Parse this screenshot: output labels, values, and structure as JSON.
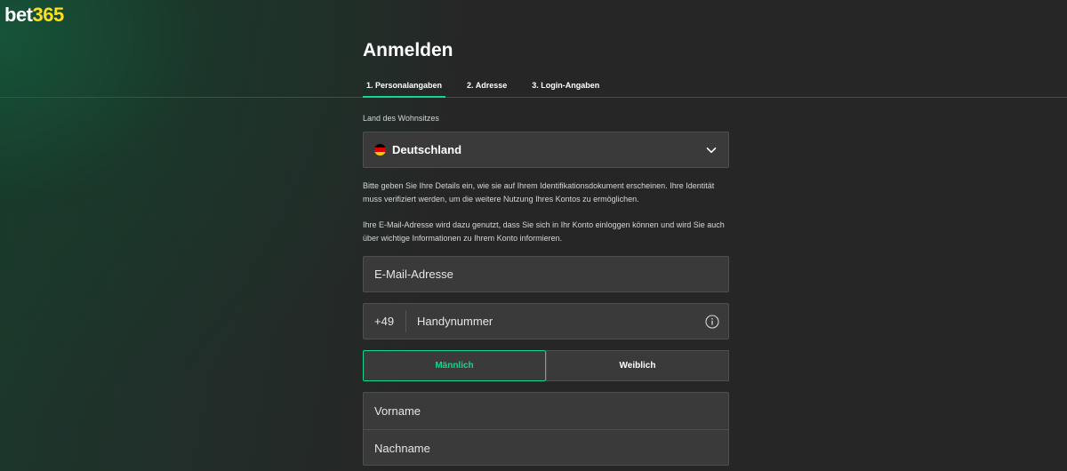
{
  "brand": {
    "logo_part1": "bet",
    "logo_part2": "365",
    "accent": "#14d58c",
    "logo_accent": "#ffdf1b"
  },
  "page": {
    "title": "Anmelden"
  },
  "steps": [
    {
      "label": "1. Personalangaben",
      "active": true
    },
    {
      "label": "2. Adresse",
      "active": false
    },
    {
      "label": "3. Login-Angaben",
      "active": false
    }
  ],
  "country": {
    "label": "Land des Wohnsitzes",
    "value": "Deutschland",
    "flag_icon": "germany-flag-icon",
    "chevron_icon": "chevron-down-icon"
  },
  "info": {
    "paragraph1": "Bitte geben Sie Ihre Details ein, wie sie auf Ihrem Identifikationsdokument erscheinen. Ihre Identität muss verifiziert werden, um die weitere Nutzung Ihres Kontos zu ermöglichen.",
    "paragraph2": "Ihre E-Mail-Adresse wird dazu genutzt, dass Sie sich in Ihr Konto einloggen können und wird Sie auch über wichtige Informationen zu Ihrem Konto informieren."
  },
  "email": {
    "placeholder": "E-Mail-Adresse",
    "value": ""
  },
  "phone": {
    "prefix": "+49",
    "placeholder": "Handynummer",
    "value": "",
    "info_icon": "info-icon"
  },
  "gender": {
    "male": "Männlich",
    "female": "Weiblich",
    "selected": "male"
  },
  "name": {
    "first_placeholder": "Vorname",
    "last_placeholder": "Nachname"
  }
}
